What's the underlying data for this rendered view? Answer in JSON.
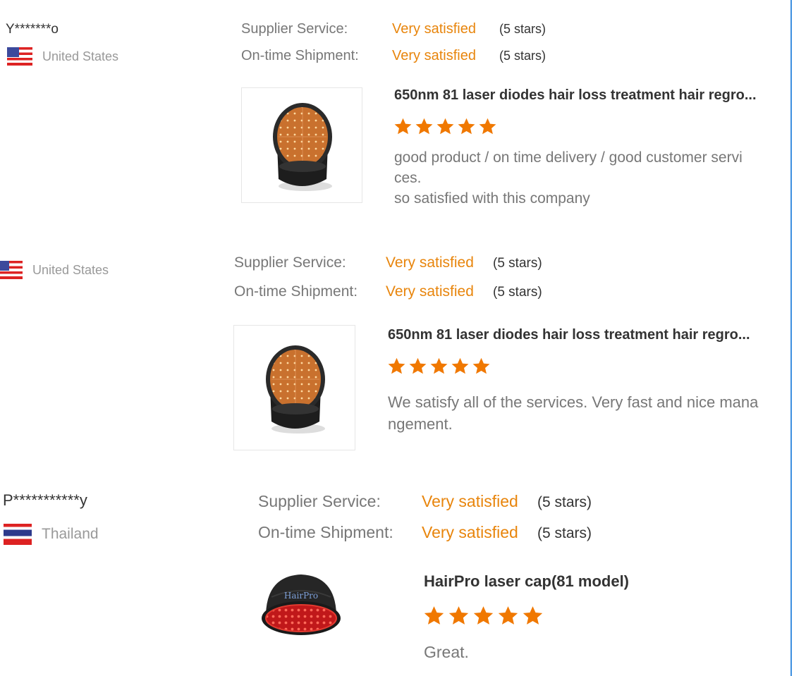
{
  "colors": {
    "accent_orange": "#e8850c",
    "star_orange": "#f07800",
    "label_gray": "#777777",
    "right_edge_blue": "#3d8fe0"
  },
  "reviews": [
    {
      "buyer": "Y*******o",
      "country": "United States",
      "flag_icon": "us-flag-icon",
      "supplier_service": {
        "label": "Supplier Service:",
        "value": "Very satisfied",
        "stars": "(5 stars)"
      },
      "shipment": {
        "label": "On-time Shipment:",
        "value": "Very satisfied",
        "stars": "(5 stars)"
      },
      "product": {
        "title": "650nm 81 laser diodes hair loss treatment hair regro...",
        "rating": 5,
        "image_icon": "laser-helmet-image"
      },
      "comment_lines": [
        "good product / on time delivery / good customer servi",
        "ces.",
        "so satisfied with this company"
      ]
    },
    {
      "buyer": "",
      "country": "United States",
      "flag_icon": "us-flag-icon",
      "supplier_service": {
        "label": "Supplier Service:",
        "value": "Very satisfied",
        "stars": "(5 stars)"
      },
      "shipment": {
        "label": "On-time Shipment:",
        "value": "Very satisfied",
        "stars": "(5 stars)"
      },
      "product": {
        "title": "650nm 81 laser diodes hair loss treatment hair regro...",
        "rating": 5,
        "image_icon": "laser-helmet-image"
      },
      "comment_lines": [
        "We satisfy all of the services. Very fast and nice mana",
        "ngement."
      ]
    },
    {
      "buyer": "P***********y",
      "country": "Thailand",
      "flag_icon": "thailand-flag-icon",
      "supplier_service": {
        "label": "Supplier Service:",
        "value": "Very satisfied",
        "stars": "(5 stars)"
      },
      "shipment": {
        "label": "On-time Shipment:",
        "value": "Very satisfied",
        "stars": "(5 stars)"
      },
      "product": {
        "title": "HairPro laser cap(81 model)",
        "rating": 5,
        "image_icon": "laser-cap-image",
        "logo_text": "HairPro"
      },
      "comment_lines": [
        "Great."
      ]
    }
  ]
}
